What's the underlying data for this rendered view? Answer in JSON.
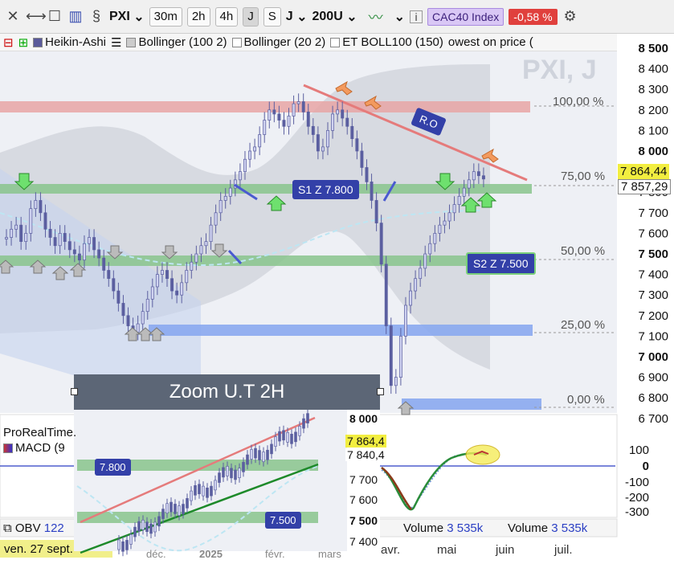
{
  "toolbar": {
    "symbol": "PXI",
    "timeframes": [
      "30m",
      "2h",
      "4h",
      "J",
      "S"
    ],
    "period": "J",
    "bars": "200U",
    "index_badge": "CAC40 Index",
    "change": "-0,58 %",
    "icons": [
      "close-icon",
      "crosshair-icon",
      "window-icon",
      "candles-icon",
      "link-icon",
      "settings-icon",
      "info-icon"
    ]
  },
  "indicators_bar": {
    "items": [
      "Heikin-Ashi",
      "Bollinger (100 2)",
      "Bollinger (20 2)",
      "ET BOLL100 (150)",
      "owest on price ("
    ]
  },
  "watermark": "PXI, J",
  "price_axis": {
    "ticks": [
      "8 500",
      "8 400",
      "8 300",
      "8 200",
      "8 100",
      "8 000",
      "7 900",
      "7 800",
      "7 700",
      "7 600",
      "7 500",
      "7 400",
      "7 300",
      "7 200",
      "7 100",
      "7 000",
      "6 900",
      "6 800",
      "6 700"
    ],
    "badge_last": "7 864,44",
    "badge_ma": "7 857,29"
  },
  "fib_levels": [
    "100,00 %",
    "75,00 %",
    "50,00 %",
    "25,00 %",
    "0,00 %"
  ],
  "annotations": {
    "s1": "S1 Z 7.800",
    "s2": "S2 Z 7.500",
    "ro": "R.O"
  },
  "macd_panel": {
    "source": "ProRealTime.",
    "label": "MACD (9",
    "ticks": [
      "100",
      "0",
      "-100",
      "-200",
      "-300"
    ]
  },
  "obv_panel": {
    "label": "OBV",
    "value": "122",
    "volume_label": "Volume",
    "volume_value": "3 535k"
  },
  "date_axis": {
    "current": "ven. 27 sept.",
    "labels": [
      "avr.",
      "mai",
      "juin",
      "juil."
    ]
  },
  "zoom": {
    "title": "Zoom U.T 2H",
    "ticks": [
      "8 000",
      "7 700",
      "7 600",
      "7 500",
      "7 400"
    ],
    "badge_last": "7 864,4",
    "badge_ma": "7 840,4",
    "label_7800": "7.800",
    "label_7500": "7.500",
    "dates": [
      "déc.",
      "2025",
      "févr.",
      "mars"
    ]
  },
  "chart_data": {
    "type": "candlestick",
    "title": "PXI, J",
    "y_range": [
      6700,
      8500
    ],
    "series": [
      {
        "name": "Heikin-Ashi",
        "values": [
          7580,
          7620,
          7640,
          7560,
          7600,
          7720,
          7760,
          7700,
          7620,
          7580,
          7540,
          7600,
          7560,
          7520,
          7500,
          7470,
          7550,
          7580,
          7520,
          7480,
          7420,
          7380,
          7320,
          7260,
          7200,
          7150,
          7120,
          7160,
          7220,
          7280,
          7340,
          7400,
          7420,
          7380,
          7320,
          7300,
          7360,
          7420,
          7460,
          7500,
          7540,
          7560,
          7640,
          7700,
          7760,
          7780,
          7820,
          7860,
          7900,
          7960,
          8000,
          8020,
          8080,
          8150,
          8200,
          8180,
          8150,
          8120,
          8170,
          8230,
          8240,
          8190,
          8120,
          8080,
          8000,
          8020,
          8100,
          8180,
          8200,
          8160,
          8120,
          8060,
          8000,
          7920,
          7850,
          7760,
          7650,
          7450,
          7150,
          6860,
          6900,
          7100,
          7250,
          7320,
          7380,
          7430,
          7500,
          7550,
          7600,
          7640,
          7660,
          7700,
          7740,
          7780,
          7820,
          7860,
          7900,
          7880,
          7864
        ]
      }
    ],
    "levels": {
      "r_100": 8220,
      "s1": 7800,
      "s2": 7500,
      "s_25": 7130,
      "s_0": 6780
    }
  }
}
